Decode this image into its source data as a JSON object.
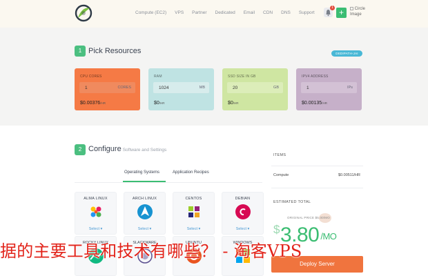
{
  "header": {
    "nav": [
      "Compute (EC2)",
      "VPS",
      "Partner",
      "Dedicated",
      "Email",
      "CDN",
      "DNS",
      "Support"
    ],
    "notification_count": "1",
    "plus_label": "+",
    "avatar_alt": "Circle Image"
  },
  "section1": {
    "step": "1",
    "title": "Pick Resources",
    "region": "DEDIPATH-JAI",
    "cards": [
      {
        "label": "CPU CORES",
        "value": "1",
        "unit": "CORES",
        "price": "$0.00376",
        "per": "/HR",
        "color": "#f57a45",
        "field_color": "#f08a5e"
      },
      {
        "label": "RAM",
        "value": "1024",
        "unit": "MB",
        "price": "$0",
        "per": "/HR",
        "color": "#bfe3e3",
        "field_color": "#d7ecec"
      },
      {
        "label": "SSD SIZE IN GB",
        "value": "20",
        "unit": "GB",
        "price": "$0",
        "per": "/HR",
        "color": "#cfe6a2",
        "field_color": "#dcedb9"
      },
      {
        "label": "IPV4 ADDRESS",
        "value": "1",
        "unit": "IPs",
        "price": "$0.00135",
        "per": "/HR",
        "color": "#c6b0c9",
        "field_color": "#d3c1d5"
      }
    ]
  },
  "section2": {
    "step": "2",
    "title": "Configure",
    "subtitle": "Software and Settings",
    "tabs": [
      "Operating Systems",
      "Application Recipes"
    ],
    "os": [
      {
        "name": "ALMA LINUX",
        "select": "Select ▾"
      },
      {
        "name": "ARCH LINUX",
        "select": "Select ▾"
      },
      {
        "name": "CENTOS",
        "select": "Select ▾"
      },
      {
        "name": "DEBIAN",
        "select": "Select ▾"
      }
    ],
    "os_row2": [
      "ROCKY LINUX",
      "SLACKWARE",
      "UBUNTU",
      "WINDOWS"
    ]
  },
  "summary": {
    "items_label": "ITEMS",
    "item_name": "Compute",
    "item_price": "$0.00511/HR",
    "estimated_label": "ESTIMATED TOTAL",
    "original_price": "ORIGINAL PRICE $5.00/MO",
    "price": "3.80",
    "currency": "$",
    "period": "/MO",
    "deploy": "Deploy Server"
  },
  "watermark": "据的主要工具和技术有哪些？ - 淘客VPS"
}
